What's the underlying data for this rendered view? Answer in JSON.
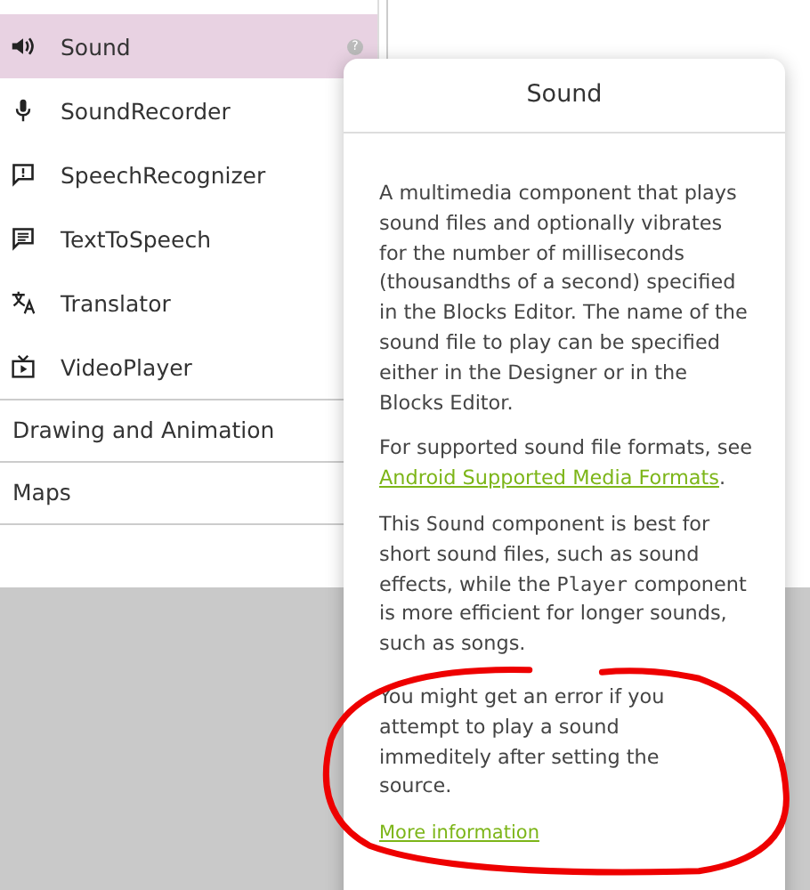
{
  "palette": {
    "items": [
      {
        "label": "Sound",
        "selected": true,
        "help": "?"
      },
      {
        "label": "SoundRecorder",
        "selected": false
      },
      {
        "label": "SpeechRecognizer",
        "selected": false
      },
      {
        "label": "TextToSpeech",
        "selected": false
      },
      {
        "label": "Translator",
        "selected": false
      },
      {
        "label": "VideoPlayer",
        "selected": false
      }
    ],
    "categories": [
      "Drawing and Animation",
      "Maps"
    ]
  },
  "popup": {
    "title": "Sound",
    "paragraphs": [
      [
        {
          "kind": "text",
          "text": "A multimedia component that plays sound files and optionally vibrates for the number of milliseconds (thousandths of a second) specified in the Blocks Editor. The name of the sound file to play can be specified either in the Designer or in the Blocks Editor."
        }
      ],
      [
        {
          "kind": "text",
          "text": "For supported sound file formats, see "
        },
        {
          "kind": "link",
          "text": "Android Supported Media Formats"
        },
        {
          "kind": "text",
          "text": "."
        }
      ],
      [
        {
          "kind": "text",
          "text": "This "
        },
        {
          "kind": "code",
          "text": "Sound"
        },
        {
          "kind": "text",
          "text": " component is best for short sound files, such as sound effects, while the "
        },
        {
          "kind": "code",
          "text": "Player"
        },
        {
          "kind": "text",
          "text": " component is more efficient for longer sounds, such as songs."
        }
      ]
    ],
    "note": "You might get an error if you attempt to play a sound immeditely after setting the source.",
    "more_link": "More information"
  }
}
